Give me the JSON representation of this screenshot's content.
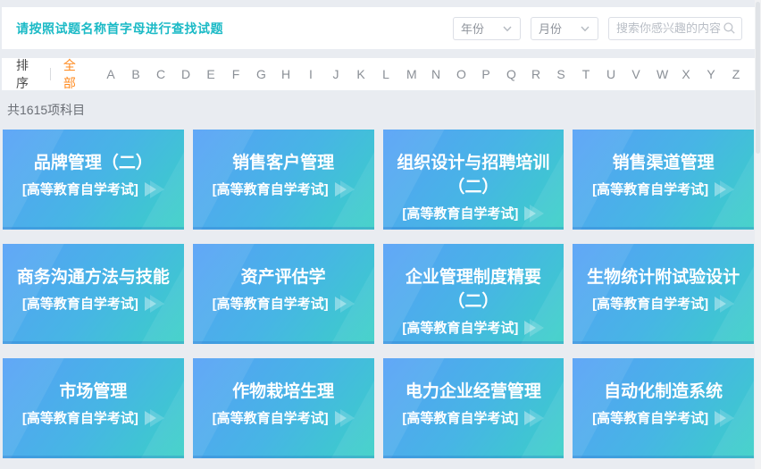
{
  "colors": {
    "accent_teal": "#1bbac6",
    "accent_orange": "#ff8a1e",
    "card_gradient_start": "#55a0f6",
    "card_gradient_end": "#3ad0c6",
    "page_bg": "#e9ecf1"
  },
  "header": {
    "notice": "请按照试题名称首字母进行查找试题",
    "year_value": "年份",
    "month_value": "月份",
    "search_placeholder": "搜索你感兴趣的内容"
  },
  "filter_bar": {
    "sort_label": "排序",
    "all_label": "全部",
    "letters": [
      "A",
      "B",
      "C",
      "D",
      "E",
      "F",
      "G",
      "H",
      "I",
      "J",
      "K",
      "L",
      "M",
      "N",
      "O",
      "P",
      "Q",
      "R",
      "S",
      "T",
      "U",
      "V",
      "W",
      "X",
      "Y",
      "Z"
    ]
  },
  "count_text": "共1615项科目",
  "cards": [
    {
      "title": "品牌管理（二）",
      "tag": "[高等教育自学考试]"
    },
    {
      "title": "销售客户管理",
      "tag": "[高等教育自学考试]"
    },
    {
      "title": "组织设计与招聘培训\n（二）",
      "tag": "[高等教育自学考试]"
    },
    {
      "title": "销售渠道管理",
      "tag": "[高等教育自学考试]"
    },
    {
      "title": "商务沟通方法与技能",
      "tag": "[高等教育自学考试]"
    },
    {
      "title": "资产评估学",
      "tag": "[高等教育自学考试]"
    },
    {
      "title": "企业管理制度精要\n（二）",
      "tag": "[高等教育自学考试]"
    },
    {
      "title": "生物统计附试验设计",
      "tag": "[高等教育自学考试]"
    },
    {
      "title": "市场管理",
      "tag": "[高等教育自学考试]"
    },
    {
      "title": "作物栽培生理",
      "tag": "[高等教育自学考试]"
    },
    {
      "title": "电力企业经营管理",
      "tag": "[高等教育自学考试]"
    },
    {
      "title": "自动化制造系统",
      "tag": "[高等教育自学考试]"
    }
  ]
}
